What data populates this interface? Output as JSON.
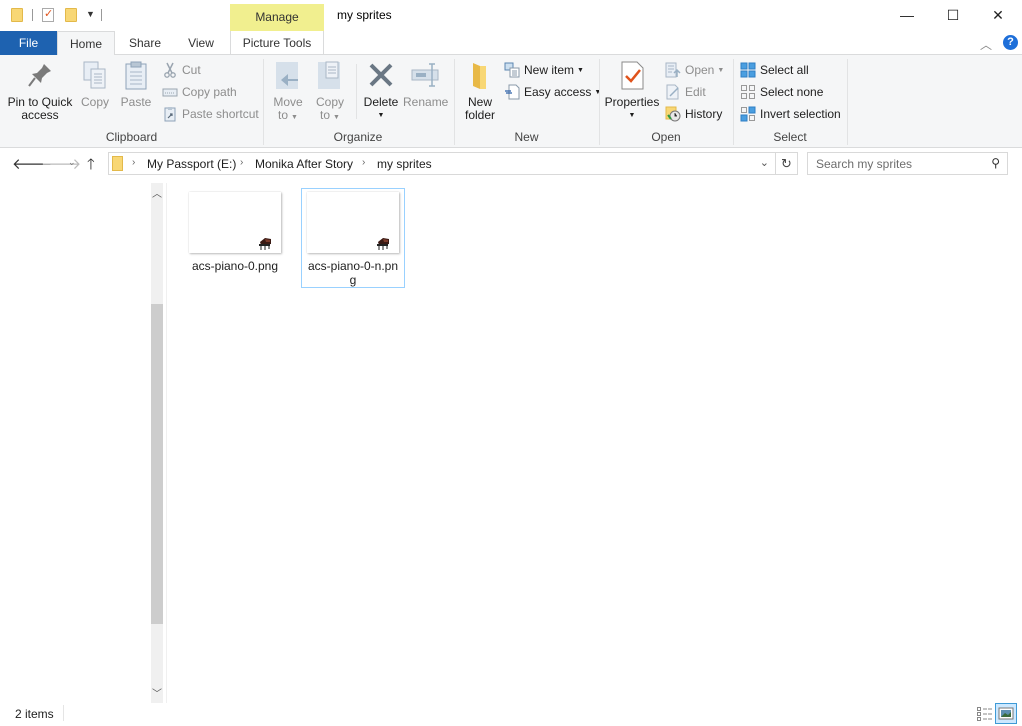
{
  "window": {
    "title": "my sprites",
    "contextual_tab_group": "Manage",
    "controls": {
      "minimize": "—",
      "maximize": "☐",
      "close": "✕"
    }
  },
  "quick_access_toolbar": {
    "items": [
      "folder-icon",
      "properties-icon",
      "new-folder-icon",
      "customize-dropdown"
    ]
  },
  "tabs": [
    {
      "label": "File",
      "active": false
    },
    {
      "label": "Home",
      "active": true
    },
    {
      "label": "Share",
      "active": false
    },
    {
      "label": "View",
      "active": false
    },
    {
      "label": "Picture Tools",
      "active": false
    }
  ],
  "ribbon": {
    "clipboard": {
      "label": "Clipboard",
      "pin_line1": "Pin to Quick",
      "pin_line2": "access",
      "copy": "Copy",
      "paste": "Paste",
      "cut": "Cut",
      "copy_path": "Copy path",
      "paste_shortcut": "Paste shortcut"
    },
    "organize": {
      "label": "Organize",
      "move_line1": "Move",
      "move_line2": "to",
      "copy_line1": "Copy",
      "copy_line2": "to",
      "delete": "Delete",
      "rename": "Rename"
    },
    "new": {
      "label": "New",
      "new_folder_line1": "New",
      "new_folder_line2": "folder",
      "new_item": "New item",
      "easy_access": "Easy access"
    },
    "open": {
      "label": "Open",
      "properties": "Properties",
      "open": "Open",
      "edit": "Edit",
      "history": "History"
    },
    "select": {
      "label": "Select",
      "select_all": "Select all",
      "select_none": "Select none",
      "invert_selection": "Invert selection"
    }
  },
  "address": {
    "breadcrumbs": [
      "My Passport (E:)",
      "Monika After Story",
      "my sprites"
    ],
    "search_placeholder": "Search my sprites"
  },
  "files": [
    {
      "name": "acs-piano-0.png",
      "selected": false
    },
    {
      "name": "acs-piano-0-n.png",
      "selected": true
    }
  ],
  "status": {
    "item_count": "2 items"
  },
  "colors": {
    "file_tab": "#1e62b0",
    "manage_highlight": "#f1ef8f",
    "selection_border": "#99d1ff",
    "help_icon": "#1e6fd9"
  }
}
